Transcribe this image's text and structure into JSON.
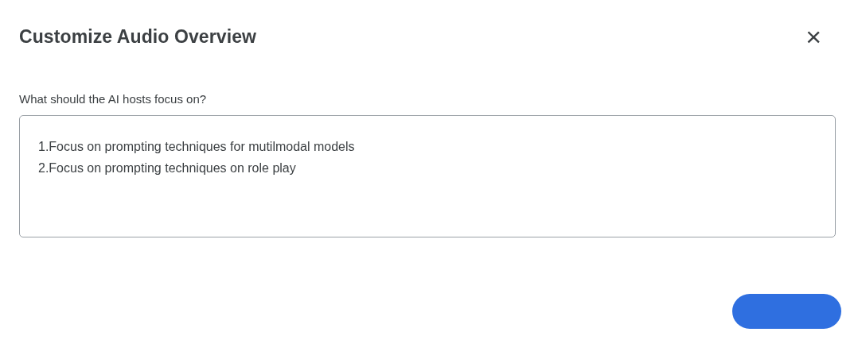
{
  "dialog": {
    "title": "Customize Audio Overview",
    "close_label": "×"
  },
  "focus_field": {
    "label": "What should the AI hosts focus on?",
    "value": "1.Focus on prompting techniques for mutilmodal models\n2.Focus on prompting techniques on role play"
  }
}
